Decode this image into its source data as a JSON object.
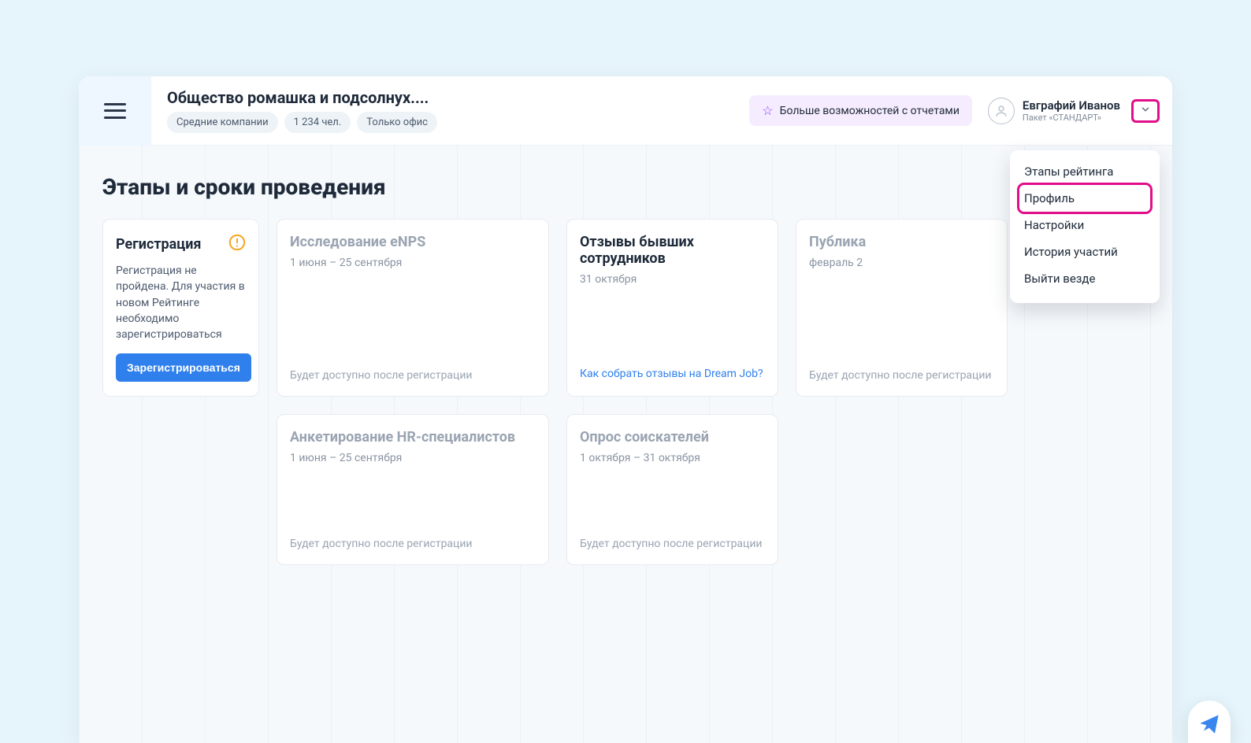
{
  "header": {
    "company_title": "Общество ромашка и подсолнух....",
    "tags": [
      "Средние компании",
      "1 234 чел.",
      "Только офис"
    ],
    "promo_label": "Больше возможностей с отчетами",
    "user": {
      "name": "Евграфий Иванов",
      "plan": "Пакет «СТАНДАРТ»"
    }
  },
  "dropdown": {
    "items": [
      "Этапы рейтинга",
      "Профиль",
      "Настройки",
      "История участий",
      "Выйти везде"
    ],
    "highlighted_index": 1
  },
  "page": {
    "heading": "Этапы и сроки проведения"
  },
  "cards": {
    "registration": {
      "title": "Регистрация",
      "desc": "Регистрация не пройдена. Для участия в новом Рейтинге необходимо зарегистрироваться",
      "button": "Зарегистрироваться"
    },
    "enps": {
      "title": "Исследование eNPS",
      "dates": "1 июня – 25 сентября",
      "locked": "Будет доступно после регистрации"
    },
    "reviews": {
      "title": "Отзывы бывших сотрудников",
      "dates": "31 октября",
      "link": "Как собрать отзывы на Dream Job?"
    },
    "publication": {
      "title": "Публика",
      "dates": "февраль 2",
      "locked": "Будет доступно после регистрации"
    },
    "hr_survey": {
      "title": "Анкетирование HR-специалистов",
      "dates": "1 июня – 25 сентября",
      "locked": "Будет доступно после регистрации"
    },
    "applicants": {
      "title": "Опрос соискателей",
      "dates": "1 октября – 31 октября",
      "locked": "Будет доступно после регистрации"
    }
  }
}
